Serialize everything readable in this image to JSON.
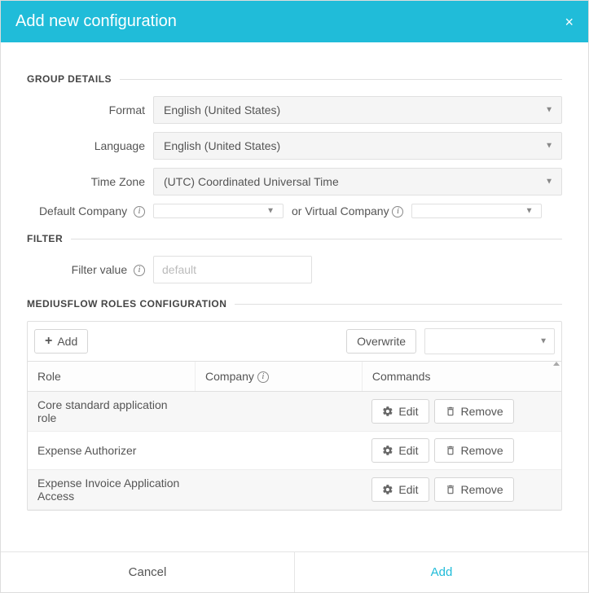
{
  "header": {
    "title": "Add new configuration",
    "close_label": "×"
  },
  "sections": {
    "group_details": "GROUP DETAILS",
    "filter": "FILTER",
    "roles": "MEDIUSFLOW ROLES CONFIGURATION"
  },
  "form": {
    "format_label": "Format",
    "format_value": "English (United States)",
    "language_label": "Language",
    "language_value": "English (United States)",
    "timezone_label": "Time Zone",
    "timezone_value": "(UTC) Coordinated Universal Time",
    "default_company_label": "Default Company",
    "or_text": "or Virtual Company",
    "filter_value_label": "Filter value",
    "filter_value_placeholder": "default"
  },
  "roles_toolbar": {
    "add_label": "Add",
    "overwrite_label": "Overwrite"
  },
  "roles_table": {
    "headers": {
      "role": "Role",
      "company": "Company",
      "commands": "Commands"
    },
    "edit_label": "Edit",
    "remove_label": "Remove",
    "rows": [
      {
        "role": "Core standard application role",
        "company": ""
      },
      {
        "role": "Expense Authorizer",
        "company": ""
      },
      {
        "role": "Expense Invoice Application Access",
        "company": ""
      }
    ]
  },
  "footer": {
    "cancel": "Cancel",
    "add": "Add"
  }
}
